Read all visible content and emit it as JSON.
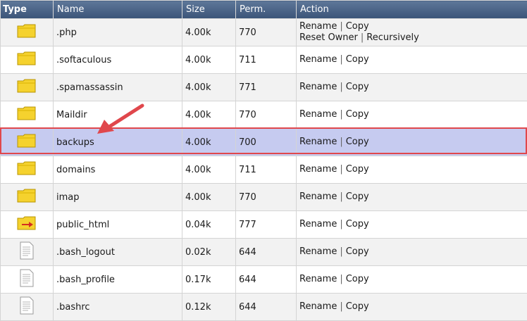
{
  "columns": {
    "type": "Type",
    "name": "Name",
    "size": "Size",
    "perm": "Perm.",
    "action": "Action"
  },
  "actions": {
    "rename": "Rename",
    "copy": "Copy",
    "reset_owner": "Reset Owner",
    "recursively": "Recursively",
    "separator": "|"
  },
  "rows": [
    {
      "icon": "folder-icon",
      "name": ".php",
      "size": "4.00k",
      "perm": "770",
      "extra": true
    },
    {
      "icon": "folder-icon",
      "name": ".softaculous",
      "size": "4.00k",
      "perm": "711"
    },
    {
      "icon": "folder-icon",
      "name": ".spamassassin",
      "size": "4.00k",
      "perm": "771"
    },
    {
      "icon": "folder-icon",
      "name": "Maildir",
      "size": "4.00k",
      "perm": "770"
    },
    {
      "icon": "folder-icon",
      "name": "backups",
      "size": "4.00k",
      "perm": "700",
      "highlighted": true
    },
    {
      "icon": "folder-icon",
      "name": "domains",
      "size": "4.00k",
      "perm": "711"
    },
    {
      "icon": "folder-icon",
      "name": "imap",
      "size": "4.00k",
      "perm": "770"
    },
    {
      "icon": "folder-link-icon",
      "name": "public_html",
      "size": "0.04k",
      "perm": "777"
    },
    {
      "icon": "file-icon",
      "name": ".bash_logout",
      "size": "0.02k",
      "perm": "644"
    },
    {
      "icon": "file-icon",
      "name": ".bash_profile",
      "size": "0.17k",
      "perm": "644"
    },
    {
      "icon": "file-icon",
      "name": ".bashrc",
      "size": "0.12k",
      "perm": "644"
    }
  ],
  "colors": {
    "header": "#4a6388",
    "highlight_bg": "#c6cbf0",
    "highlight_border": "#e0474c",
    "arrow": "#e0474c",
    "folder": "#f5d22e"
  }
}
